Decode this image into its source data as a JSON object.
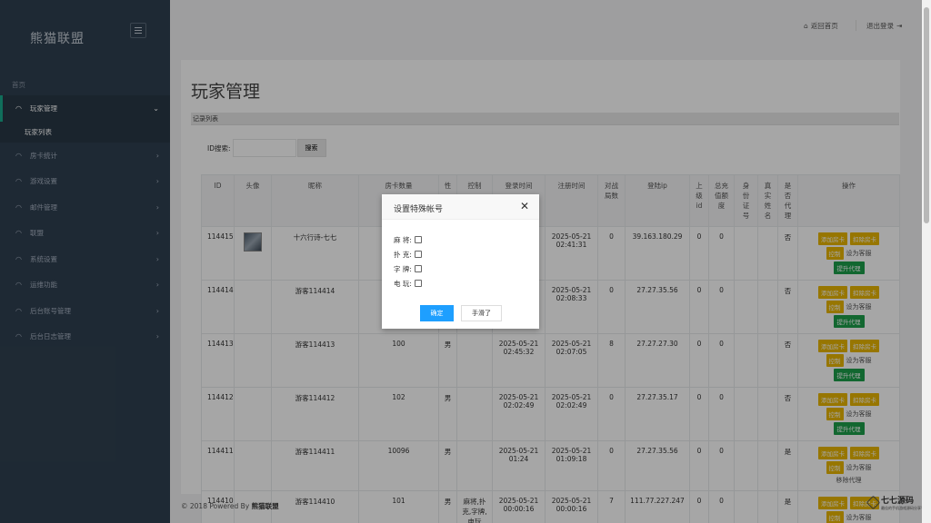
{
  "brand": {
    "name": "熊猫联盟"
  },
  "sidebar": {
    "home_label": "首页",
    "items": [
      {
        "label": "玩家管理",
        "active": true
      },
      {
        "label": "房卡统计"
      },
      {
        "label": "游戏设置"
      },
      {
        "label": "邮件管理"
      },
      {
        "label": "联盟"
      },
      {
        "label": "系统设置"
      },
      {
        "label": "运维功能"
      },
      {
        "label": "后台账号管理"
      },
      {
        "label": "后台日志管理"
      }
    ],
    "sub_items": [
      {
        "label": "玩家列表"
      }
    ]
  },
  "topbar": {
    "home": "返回首页",
    "logout": "退出登录"
  },
  "page": {
    "title": "玩家管理",
    "section": "记录列表",
    "search_label": "ID搜索:",
    "search_value": "",
    "search_button": "搜索"
  },
  "table": {
    "headers": [
      "ID",
      "头像",
      "昵称",
      "房卡数量",
      "性",
      "控制",
      "登录时间",
      "注册时间",
      "对战\n局数",
      "登陆ip",
      "上\n级\nid",
      "总充\n值额\n度",
      "身\n份\n证\n号",
      "真\n实\n姓\n名",
      "是\n否\n代\n理",
      "操作"
    ],
    "rows": [
      {
        "id": "114415",
        "avatar": true,
        "nick": "十六行诗-七七",
        "cards": "",
        "sex": "",
        "ctrl": "",
        "login": "",
        "reg": "2025-05-21\n02:41:31",
        "games": "0",
        "ip": "39.163.180.29",
        "parent": "0",
        "recharge": "0",
        "idcard": "",
        "realname": "",
        "agent": "否",
        "agent_action": "提升代理"
      },
      {
        "id": "114414",
        "avatar": false,
        "nick": "游客114414",
        "cards": "",
        "sex": "",
        "ctrl": "",
        "login": "",
        "reg": "2025-05-21\n02:08:33",
        "games": "0",
        "ip": "27.27.35.56",
        "parent": "0",
        "recharge": "0",
        "idcard": "",
        "realname": "",
        "agent": "否",
        "agent_action": "提升代理"
      },
      {
        "id": "114413",
        "avatar": false,
        "nick": "游客114413",
        "cards": "100",
        "sex": "男",
        "ctrl": "",
        "login": "2025-05-21\n02:45:32",
        "reg": "2025-05-21\n02:07:05",
        "games": "8",
        "ip": "27.27.27.30",
        "parent": "0",
        "recharge": "0",
        "idcard": "",
        "realname": "",
        "agent": "否",
        "agent_action": "提升代理"
      },
      {
        "id": "114412",
        "avatar": false,
        "nick": "游客114412",
        "cards": "102",
        "sex": "男",
        "ctrl": "",
        "login": "2025-05-21\n02:02:49",
        "reg": "2025-05-21\n02:02:49",
        "games": "0",
        "ip": "27.27.35.17",
        "parent": "0",
        "recharge": "0",
        "idcard": "",
        "realname": "",
        "agent": "否",
        "agent_action": "提升代理"
      },
      {
        "id": "114411",
        "avatar": false,
        "nick": "游客114411",
        "cards": "10096",
        "sex": "男",
        "ctrl": "",
        "login": "2025-05-21\n01:24",
        "reg": "2025-05-21\n01:09:18",
        "games": "0",
        "ip": "27.27.35.56",
        "parent": "0",
        "recharge": "0",
        "idcard": "",
        "realname": "",
        "agent": "是",
        "agent_action": "移除代理"
      },
      {
        "id": "114410",
        "avatar": false,
        "nick": "游客114410",
        "cards": "101",
        "sex": "男",
        "ctrl": "麻将,扑\n克,字牌,\n电玩",
        "login": "2025-05-21\n00:00:16",
        "reg": "2025-05-21\n00:00:16",
        "games": "7",
        "ip": "111.77.227.247",
        "parent": "0",
        "recharge": "0",
        "idcard": "",
        "realname": "",
        "agent": "是",
        "agent_action": ""
      }
    ],
    "ops": {
      "add": "添加房卡",
      "deduct": "扣除房卡",
      "control": "控制",
      "service": "设为客服"
    }
  },
  "modal": {
    "title": "设置特殊帐号",
    "options": [
      "麻 将:",
      "扑 克:",
      "字 牌:",
      "电 玩:"
    ],
    "ok": "确定",
    "cancel": "手滑了"
  },
  "footer": {
    "prefix": "© 2018 Powered By",
    "brand": "熊猫联盟"
  },
  "watermark": {
    "main": "七七源码",
    "sub": "最佳的手机游戏源码分享平台"
  }
}
